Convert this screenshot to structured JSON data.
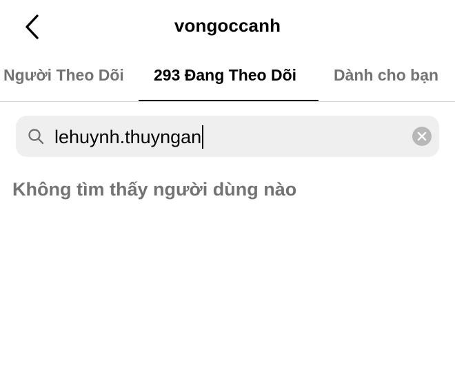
{
  "header": {
    "title": "vongoccanh",
    "back_icon": "chevron-left-icon"
  },
  "tabs": [
    {
      "label": "Người Theo Dõi",
      "active": false
    },
    {
      "label": "293 Đang Theo Dõi",
      "active": true
    },
    {
      "label": "Dành cho bạn",
      "active": false
    }
  ],
  "search": {
    "icon": "search-icon",
    "value": "lehuynh.thuyngan",
    "clear_icon": "clear-icon"
  },
  "results": {
    "empty_message": "Không tìm thấy người dùng nào"
  },
  "colors": {
    "background": "#ffffff",
    "text": "#000000",
    "muted": "#737373",
    "search_bg": "#efefef",
    "clear_bg": "#b8b8b8",
    "divider": "#dbdbdb"
  }
}
